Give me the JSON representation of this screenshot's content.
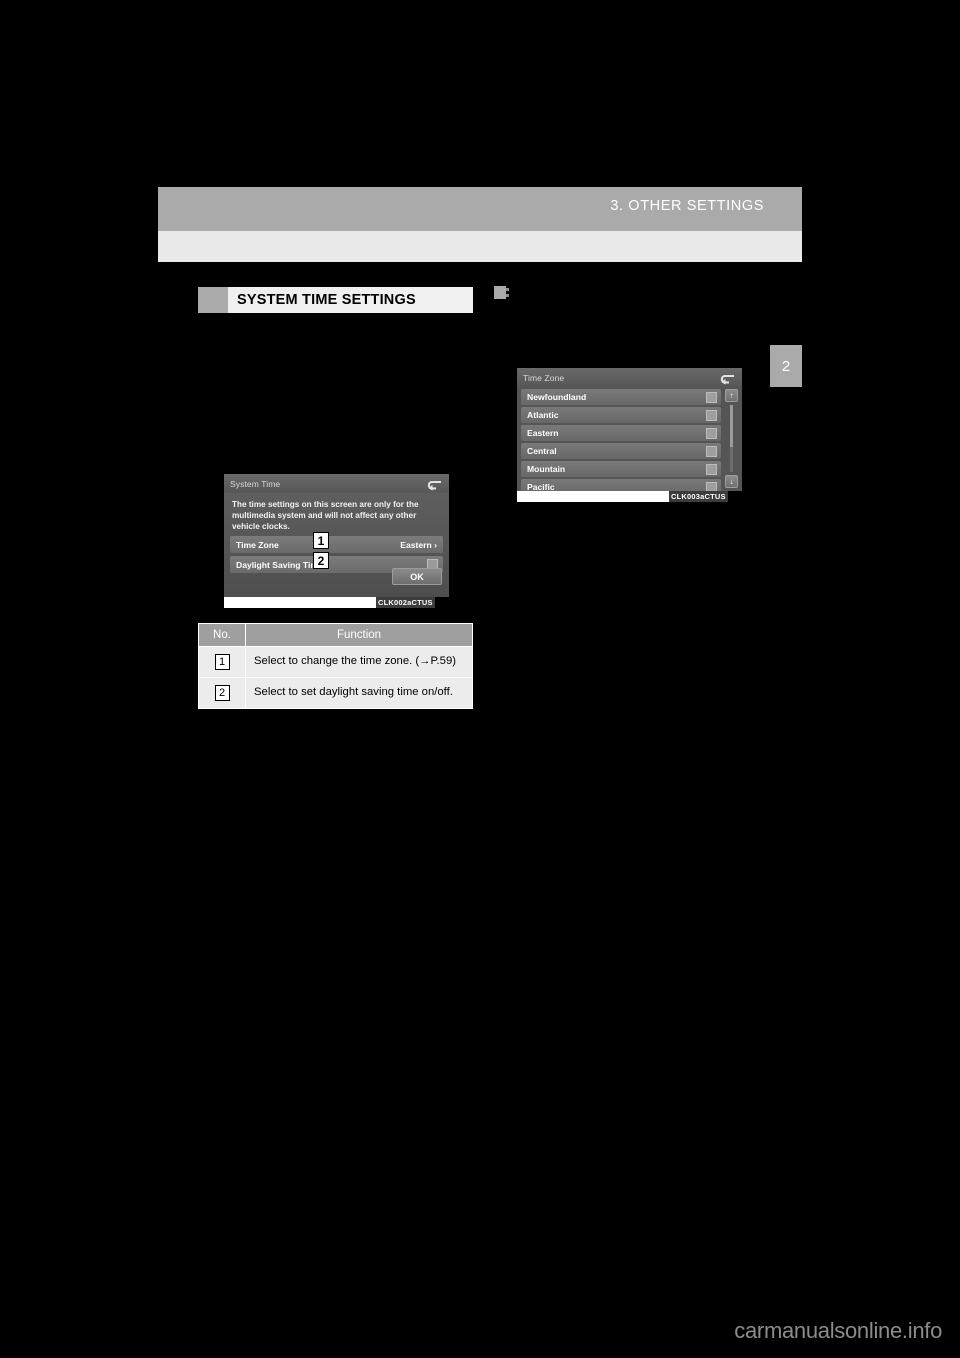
{
  "page": {
    "header_title": "3. OTHER SETTINGS",
    "chapter_tab": "2",
    "watermark": "carmanualsonline.info"
  },
  "section": {
    "heading": "SYSTEM TIME SETTINGS"
  },
  "figures": {
    "system_time": {
      "code": "CLK002aCTUS",
      "title": "System Time",
      "back_icon": "back-arrow-icon",
      "note": "The time settings on this screen are only for the multimedia system and will not affect any other vehicle clocks.",
      "rows": [
        {
          "label": "Time Zone",
          "value": "Eastern ›",
          "callout": "1"
        },
        {
          "label": "Daylight Saving Time",
          "value": "",
          "callout": "2"
        }
      ],
      "ok_label": "OK"
    },
    "time_zone": {
      "code": "CLK003aCTUS",
      "title": "Time Zone",
      "back_icon": "back-arrow-icon",
      "items": [
        "Newfoundland",
        "Atlantic",
        "Eastern",
        "Central",
        "Mountain",
        "Pacific"
      ],
      "scroll_up_icon": "↑",
      "scroll_down_icon": "↓"
    }
  },
  "function_table": {
    "headers": {
      "no": "No.",
      "function": "Function"
    },
    "rows": [
      {
        "no": "1",
        "text": "Select to change the time zone. (→P.59)"
      },
      {
        "no": "2",
        "text": "Select to set daylight saving time on/off."
      }
    ]
  },
  "colors": {
    "header_gray": "#aaaaaa",
    "band_gray": "#e9e9e9",
    "table_header_gray": "#9f9f9f",
    "table_body_gray": "#ececec"
  }
}
